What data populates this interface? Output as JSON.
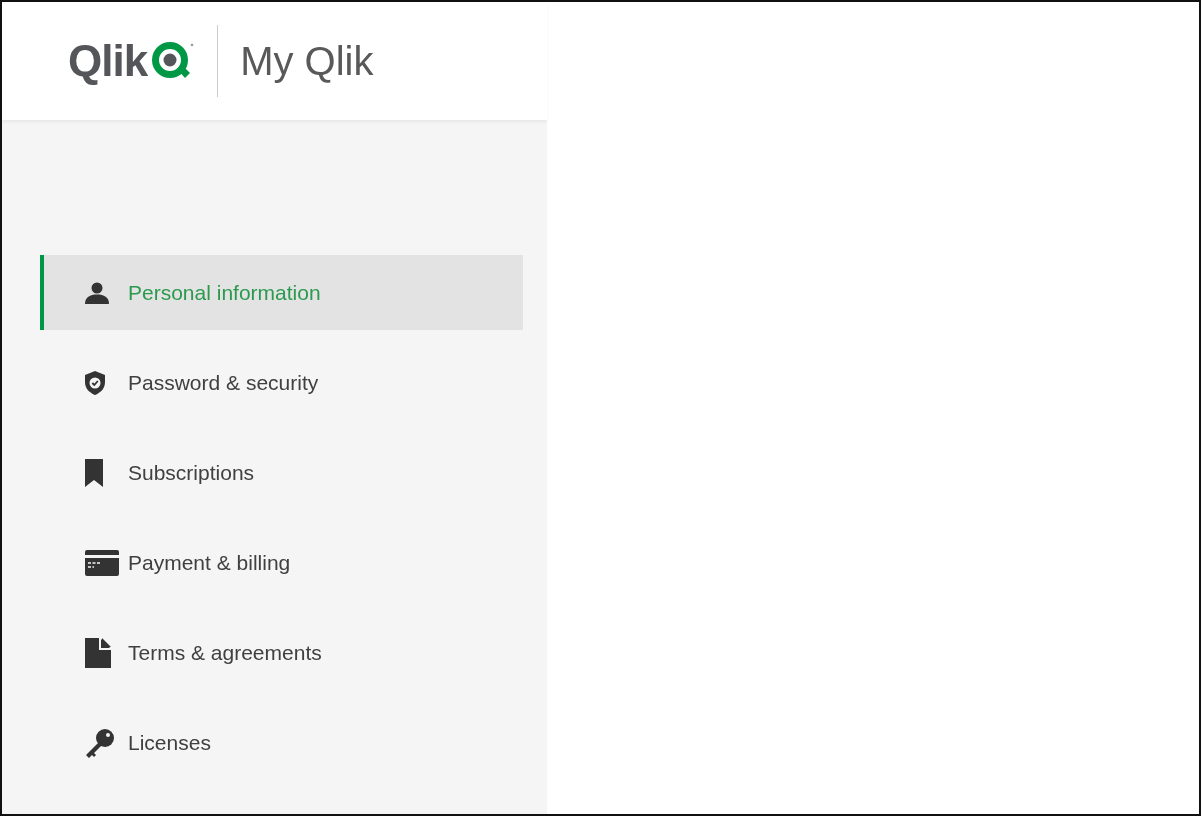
{
  "header": {
    "logo_text": "Qlik",
    "product": "My Qlik"
  },
  "sidebar": {
    "items": [
      {
        "label": "Personal information",
        "selected": true
      },
      {
        "label": "Password & security",
        "selected": false
      },
      {
        "label": "Subscriptions",
        "selected": false
      },
      {
        "label": "Payment & billing",
        "selected": false
      },
      {
        "label": "Terms & agreements",
        "selected": false
      },
      {
        "label": "Licenses",
        "selected": false
      }
    ]
  }
}
